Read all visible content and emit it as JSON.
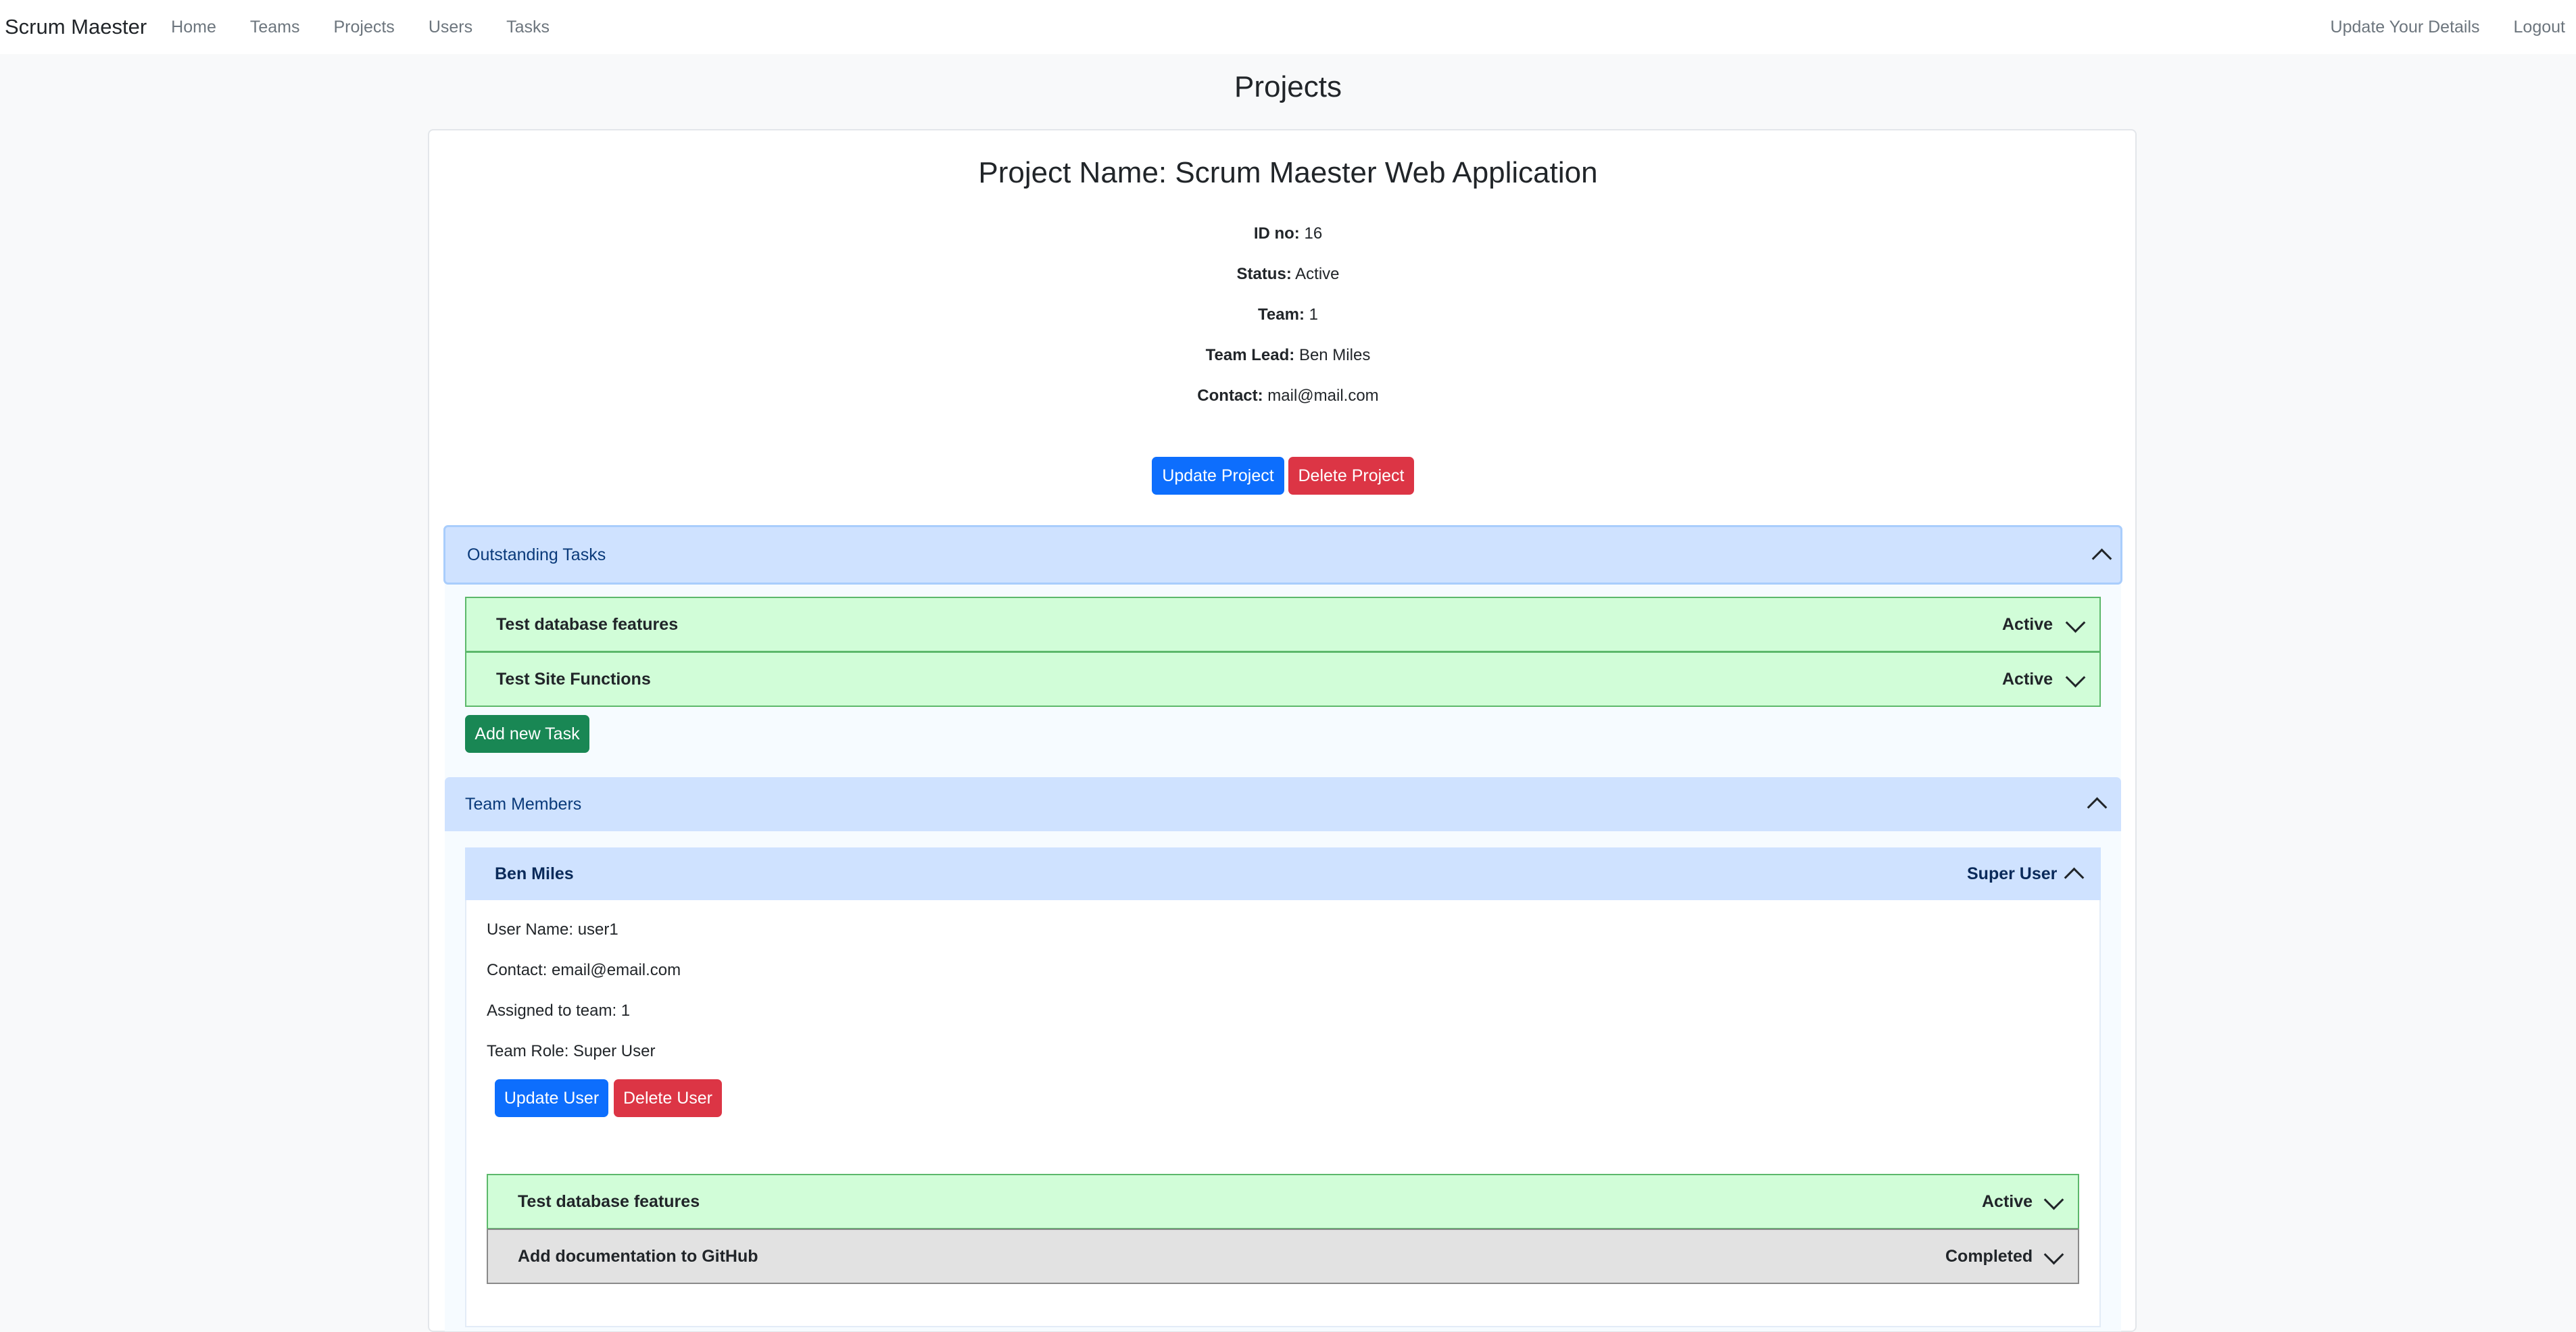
{
  "nav": {
    "brand": "Scrum Maester",
    "links": [
      "Home",
      "Teams",
      "Projects",
      "Users",
      "Tasks"
    ],
    "right_links": [
      "Update Your Details",
      "Logout"
    ]
  },
  "page": {
    "title": "Projects"
  },
  "project": {
    "name": "Project Name: Scrum Maester Web Application",
    "id_label": "ID no:",
    "id_value": "16",
    "status_label": "Status:",
    "status_value": "Active",
    "team_label": "Team:",
    "team_value": "1",
    "lead_label": "Team Lead:",
    "lead_value": "Ben Miles",
    "contact_label": "Contact:",
    "contact_value": "mail@mail.com",
    "update_label": "Update Project",
    "delete_label": "Delete Project"
  },
  "outstanding": {
    "title": "Outstanding Tasks",
    "tasks": [
      {
        "name": "Test database features",
        "status": "Active"
      },
      {
        "name": "Test Site Functions",
        "status": "Active"
      }
    ],
    "add_label": "Add new Task"
  },
  "members": {
    "title": "Team Members",
    "user": {
      "name": "Ben Miles",
      "role_badge": "Super User",
      "username": "User Name: user1",
      "contact": "Contact: email@email.com",
      "assigned": "Assigned to team: 1",
      "role": "Team Role: Super User",
      "update_label": "Update User",
      "delete_label": "Delete User",
      "tasks": [
        {
          "name": "Test database features",
          "status": "Active"
        },
        {
          "name": "Add documentation to GitHub",
          "status": "Completed"
        }
      ]
    }
  },
  "colors": {
    "primary": "#0d6efd",
    "danger": "#dc3545",
    "success": "#198754",
    "accordion_active": "#cfe2ff",
    "task_active_bg": "#d1fdd8",
    "task_completed_bg": "#e2e2e2"
  }
}
